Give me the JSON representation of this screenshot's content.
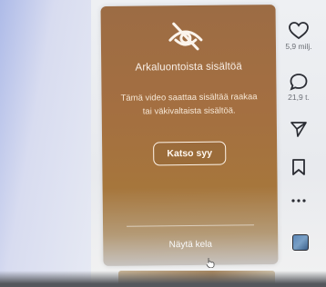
{
  "sensitive_content": {
    "title": "Arkaluontoista sisältöä",
    "body": "Tämä video saattaa sisältää raakaa tai väkivaltaista sisältöä.",
    "reason_button": "Katso syy",
    "show_reel": "Näytä kela"
  },
  "actions": {
    "likes": "5,9 milj.",
    "comments": "21,9 t."
  },
  "icons": {
    "hidden": "eye-slash-icon",
    "like": "heart-icon",
    "comment": "comment-icon",
    "share": "send-icon",
    "save": "bookmark-icon",
    "more": "ellipsis-icon",
    "audio": "audio-thumbnail-icon"
  },
  "colors": {
    "overlay": "#a46f41",
    "text": "#f8efe6",
    "rail_icon": "#2a2c33",
    "rail_count": "#6b6e75"
  }
}
